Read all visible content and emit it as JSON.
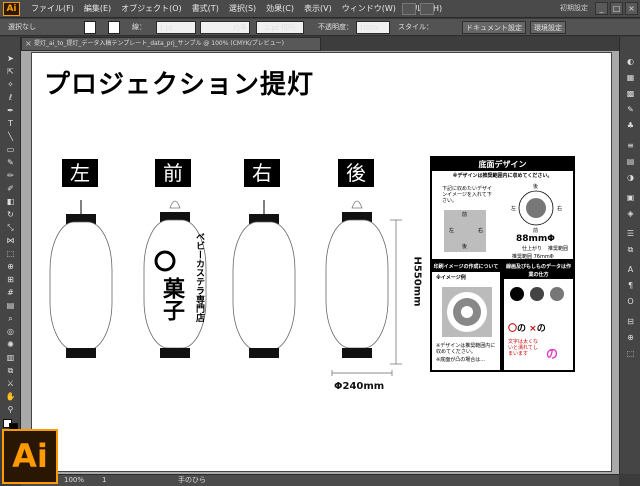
{
  "app": {
    "logo": "Ai",
    "workspace": "初期設定",
    "win_buttons": [
      "_",
      "□",
      "×"
    ]
  },
  "menu": [
    "ファイル(F)",
    "編集(E)",
    "オブジェクト(O)",
    "書式(T)",
    "選択(S)",
    "効果(C)",
    "表示(V)",
    "ウィンドウ(W)",
    "ヘルプ(H)"
  ],
  "control": {
    "selection": "選択なし",
    "stroke_label": "線：",
    "stroke_value": "1 pt",
    "profile": "均等",
    "brush": "2 pt 楕円",
    "opacity_label": "不透明度：",
    "opacity_value": "100%",
    "style_label": "スタイル：",
    "doc_settings": "ドキュメント設定",
    "env_settings": "環境設定"
  },
  "document_tab": "提灯_ai_to_提灯_データ入稿テンプレート_data_prj_サンプル @ 100% (CMYK/プレビュー)",
  "artwork": {
    "title": "プロジェクション提灯",
    "views": [
      "左",
      "前",
      "右",
      "後"
    ],
    "lantern_brand_line1": "ベビーカステラ専門店",
    "lantern_brand_line2": "菓子",
    "height_label": "H550mm",
    "diameter_label": "Φ240mm"
  },
  "bottom_panel": {
    "title": "底面デザイン",
    "notice": "※デザインは推奨範囲内に収めてください。",
    "instruction": "下記に収めたいデザインイメージを入れて下さい。",
    "dir_front": "前",
    "dir_back": "後",
    "dir_left": "左",
    "dir_right": "右",
    "diameter": "88mmΦ",
    "finish": "仕上がり",
    "recommended": "推奨範囲",
    "recommended_size": "推奨範囲 76mmΦ"
  },
  "image_panel": {
    "title": "印刷イメージの作成について",
    "example": "※イメージ例",
    "notice": "※デザインは推奨範囲内に収めてください。",
    "note2": "※底面が凸の場合は..."
  },
  "guide_panel": {
    "title": "線画及びもしものデータは作業の仕方",
    "ok": "〇",
    "ng": "×",
    "text_sample": "の",
    "note": "文字は太くないと潰れてしまいます"
  },
  "status": {
    "zoom": "100%",
    "page": "1",
    "tool_name": "手のひら"
  },
  "colors": {
    "accent": "#ff9a00",
    "chrome": "#535353",
    "canvas": "#a9a9a9",
    "pink": "#e040c0"
  }
}
